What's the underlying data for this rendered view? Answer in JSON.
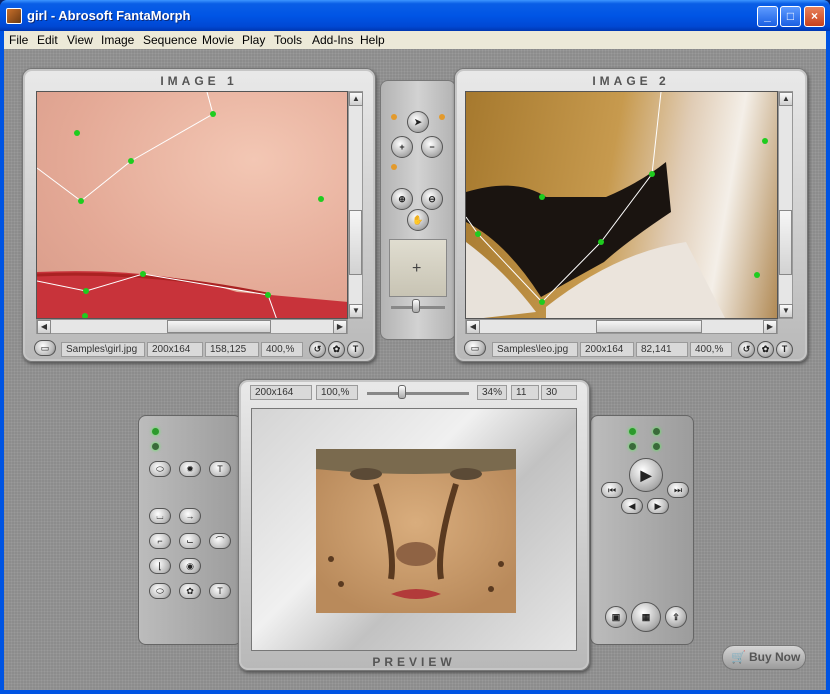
{
  "window": {
    "title": "girl - Abrosoft FantaMorph",
    "min": "_",
    "max": "□",
    "close": "×"
  },
  "menu": [
    "File",
    "Edit",
    "View",
    "Image",
    "Sequence",
    "Movie",
    "Play",
    "Tools",
    "Add-Ins",
    "Help"
  ],
  "image1": {
    "title": "IMAGE 1",
    "path": "Samples\\girl.jpg",
    "size": "200x164",
    "coords": "158,125",
    "zoom": "400,%"
  },
  "image2": {
    "title": "IMAGE 2",
    "path": "Samples\\leo.jpg",
    "size": "200x164",
    "coords": "82,141",
    "zoom": "400,%"
  },
  "preview": {
    "title": "PREVIEW",
    "size": "200x164",
    "zoom": "100,%",
    "percent": "34%",
    "frame": "11",
    "frames": "30",
    "slider_fraction": 0.34
  },
  "buttons": {
    "buy_now": "Buy Now",
    "T": "T"
  },
  "colors": {
    "title_blue": "#0055e5",
    "panel_grey": "#d0d0d0",
    "key_point": "#1fcc1f",
    "menu_bg": "#ece9d8"
  },
  "icons": [
    "arrow-cursor-icon",
    "add-point-icon",
    "remove-point-icon",
    "zoom-in-icon",
    "zoom-out-icon",
    "hand-icon",
    "crosshair-icon",
    "play-icon",
    "camera-icon",
    "film-icon",
    "cart-icon"
  ]
}
